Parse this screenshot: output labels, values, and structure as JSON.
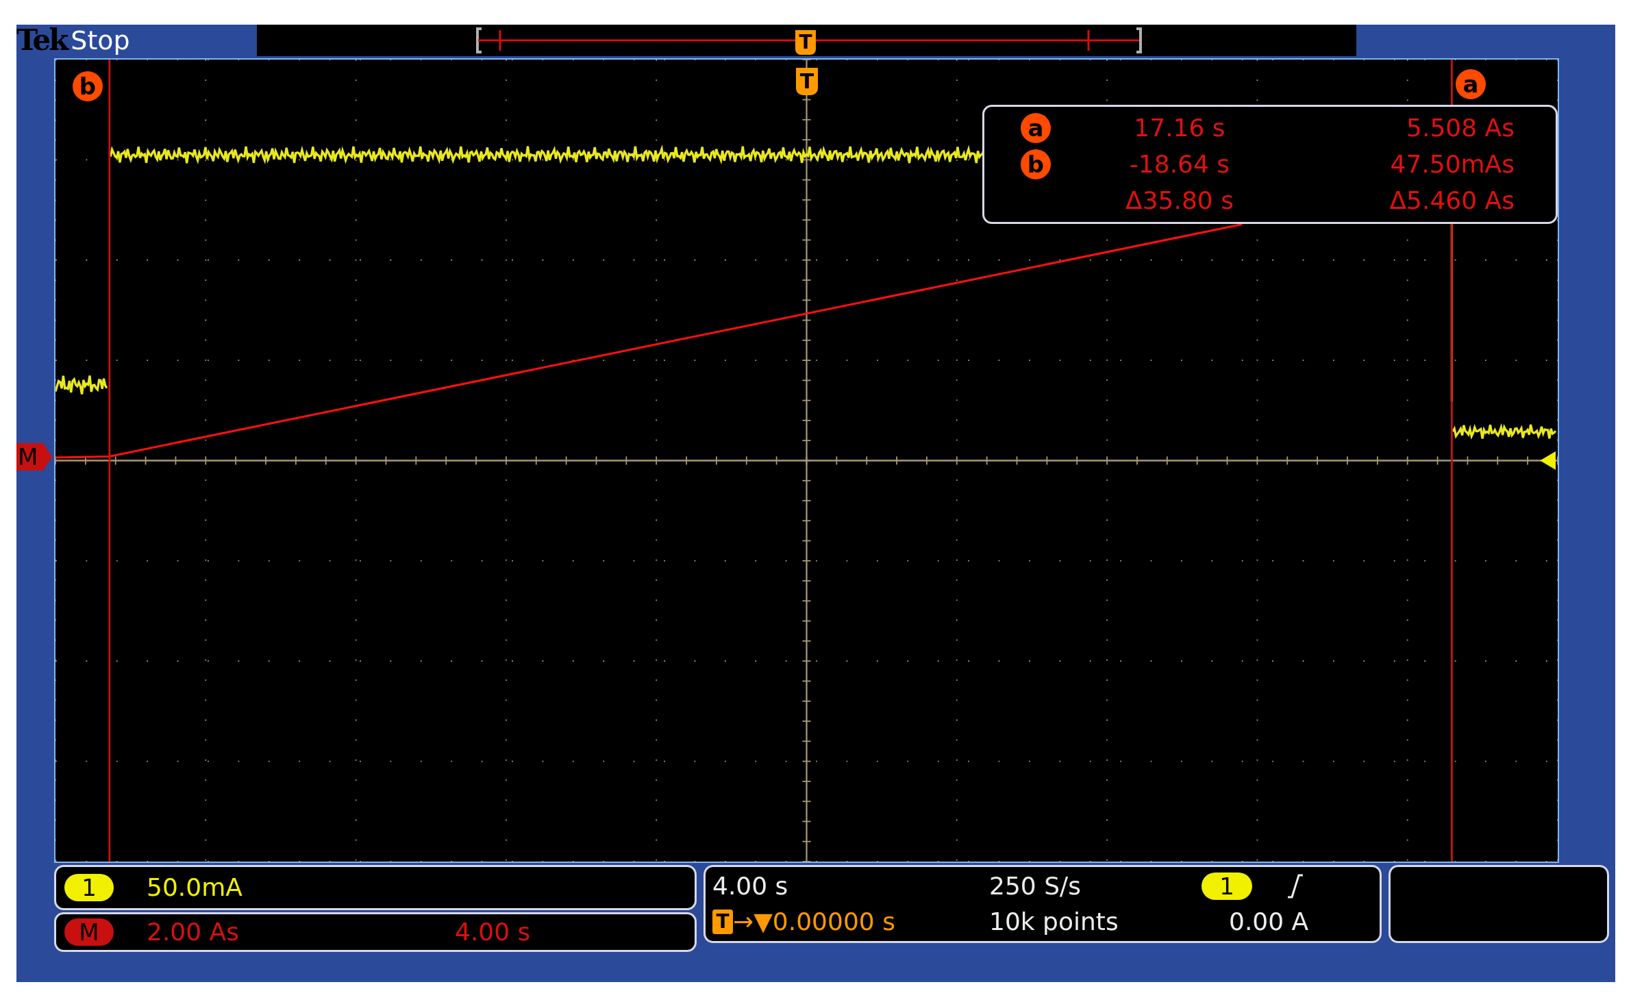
{
  "header": {
    "brand": "Tek",
    "status": "Stop"
  },
  "record_overview": {
    "trigger_label": "T"
  },
  "graticule": {
    "trigger_label": "T",
    "reference_label": "M",
    "cursor_labels": [
      {
        "label": "b",
        "kind": "left"
      },
      {
        "label": "a",
        "kind": "right"
      }
    ],
    "readout": [
      {
        "marker": "a",
        "time": "17.16 s",
        "value": "5.508 As"
      },
      {
        "marker": "b",
        "time": "-18.64 s",
        "value": "47.50mAs"
      },
      {
        "time": "Δ35.80 s",
        "value": "Δ5.460 As"
      }
    ]
  },
  "channels": [
    {
      "kind": "channel",
      "badge": "1",
      "scale": "50.0mA"
    },
    {
      "kind": "math",
      "badge": "M",
      "scale": "2.00 As",
      "timebase": "4.00 s"
    }
  ],
  "acquisition": {
    "horizontal_scale": "4.00 s",
    "trigger_badge": "T",
    "position_prefix": "→▼",
    "position": "0.00000 s",
    "sample_rate": "250 S/s",
    "record_length": "10k points",
    "trigger_source": "1",
    "trigger_level": "0.00 A"
  }
}
